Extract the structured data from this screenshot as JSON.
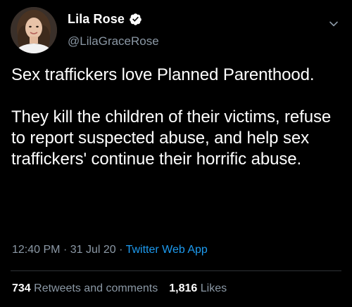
{
  "tweet": {
    "author": {
      "display_name": "Lila Rose",
      "handle": "@LilaGraceRose",
      "verified": true
    },
    "text": {
      "paragraph_1": "Sex traffickers love Planned Parenthood.",
      "paragraph_2": "They kill the children of their victims, refuse to report suspected abuse, and help sex traffickers' continue their horrific abuse."
    },
    "meta": {
      "time": "12:40 PM",
      "separator": "·",
      "date": "31 Jul 20",
      "source": "Twitter Web App"
    },
    "stats": {
      "retweets_count": "734",
      "retweets_label": "Retweets and comments",
      "likes_count": "1,816",
      "likes_label": "Likes"
    }
  },
  "icons": {
    "verified": "verified-badge-icon",
    "menu": "chevron-down-icon"
  },
  "colors": {
    "background": "#000000",
    "text_primary": "#ffffff",
    "text_secondary": "#8b98a5",
    "accent": "#1d9bf0",
    "divider": "#2f3336"
  }
}
